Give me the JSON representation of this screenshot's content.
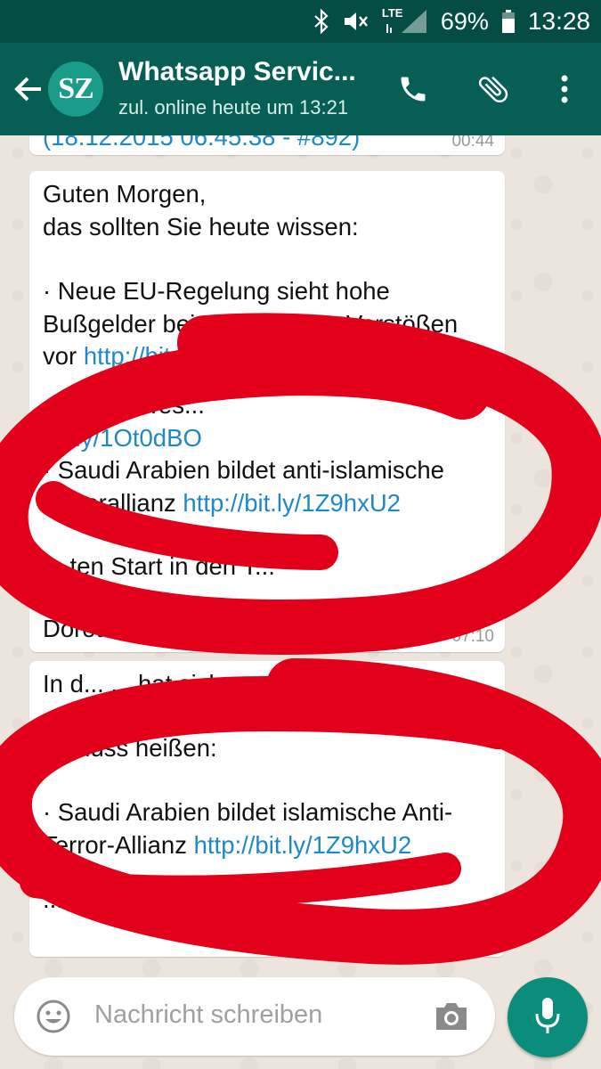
{
  "status_bar": {
    "network": "LTE",
    "battery": "69%",
    "time": "13:28"
  },
  "chat": {
    "title": "Whatsapp Servic...",
    "subtitle": "zul. online heute um 13:21",
    "avatar_text": "SZ"
  },
  "messages": [
    {
      "text_visible": "(18.12.2015 06:45:38 - #892)",
      "time": "00:44"
    },
    {
      "greeting": "Guten Morgen,\ndas sollten Sie heute wissen:",
      "item1": "· Neue EU-Regelung sieht hohe Bußgelder bei Datenschutz-Verstößen vor",
      "link1": "http://bit.ly/1zYS",
      "item2_tail": "... Abgas-Tes...",
      "link2": "bit.ly/1Ot0dBO",
      "item3": "· Saudi Arabien bildet anti-islamische Terrorallianz",
      "link3": "http://bit.ly/1Z9hxU2",
      "closing": "... ten Start in den T...",
      "signature": "Doroth...",
      "time": "07:10"
    },
    {
      "intro": "In d... ... hat sich",
      "intro2": "... muss heißen:",
      "item": "· Saudi Arabien bildet islamische Anti-Terror-Allianz",
      "link": "http://bit.ly/1Z9hxU2",
      "tail": "... Bi...",
      "time": "0..."
    }
  ],
  "input": {
    "placeholder": "Nachricht schreiben"
  },
  "colors": {
    "toolbar": "#075e54",
    "status_bar": "#054d44",
    "link": "#1e88c8",
    "annotation": "#e3001b"
  },
  "icons": [
    "bluetooth-icon",
    "mute-icon",
    "signal-icon",
    "battery-icon",
    "back-arrow-icon",
    "phone-icon",
    "attach-icon",
    "more-icon",
    "emoji-icon",
    "camera-icon",
    "mic-icon"
  ]
}
